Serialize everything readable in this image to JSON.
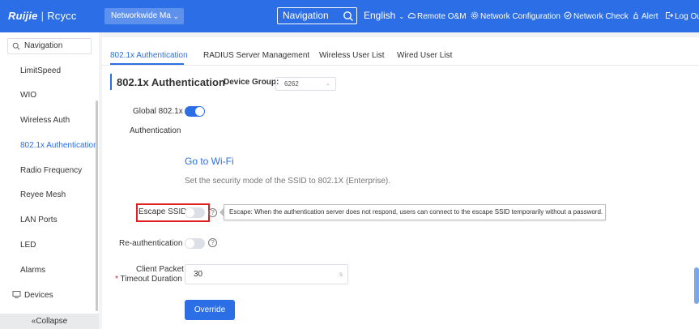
{
  "header": {
    "logo_brand": "Ruijie",
    "logo_separator": "|",
    "logo_sub": "Rcycc",
    "network_select": "Networkwide Ma",
    "search_text": "Navigation",
    "language": "English",
    "links": {
      "remote": "Remote O&M",
      "network_config": "Network Configuration",
      "network_check": "Network Check",
      "alert": "Alert",
      "logout": "Log Ou"
    }
  },
  "sidebar": {
    "search_placeholder": "Navigation",
    "items": [
      "LimitSpeed",
      "WIO",
      "Wireless Auth",
      "802.1x Authentication",
      "Radio Frequency",
      "Reyee Mesh",
      "LAN Ports",
      "LED",
      "Alarms"
    ],
    "active_item": "802.1x Authentication",
    "devices": "Devices",
    "collapse": "Collapse"
  },
  "tabs": [
    "802.1x Authentication",
    "RADIUS Server Management",
    "Wireless User List",
    "Wired User List"
  ],
  "main": {
    "title": "802.1x Authentication",
    "device_group_label": "Device Group:",
    "device_group_value": "6262",
    "global_label_line1": "Global 802.1x",
    "global_label_line2": "Authentication",
    "global_enabled": true,
    "goto_link": "Go to Wi-Fi",
    "description": "Set the security mode of the SSID to 802.1X (Enterprise).",
    "escape_label": "Escape SSID",
    "escape_enabled": false,
    "escape_tooltip": "Escape: When the authentication server does not respond, users can connect to the escape SSID temporarily without a password.",
    "reauth_label": "Re-authentication",
    "reauth_enabled": false,
    "timeout_label_line1": "Client Packet",
    "timeout_required_mark": "*",
    "timeout_label_line2": "Timeout Duration",
    "timeout_value": "30",
    "timeout_unit": "s",
    "override_button": "Override",
    "help_glyph": "?"
  },
  "colors": {
    "primary": "#2b6ee6",
    "highlight_box": "#e02020",
    "toggle_off": "#dcdfe6"
  }
}
